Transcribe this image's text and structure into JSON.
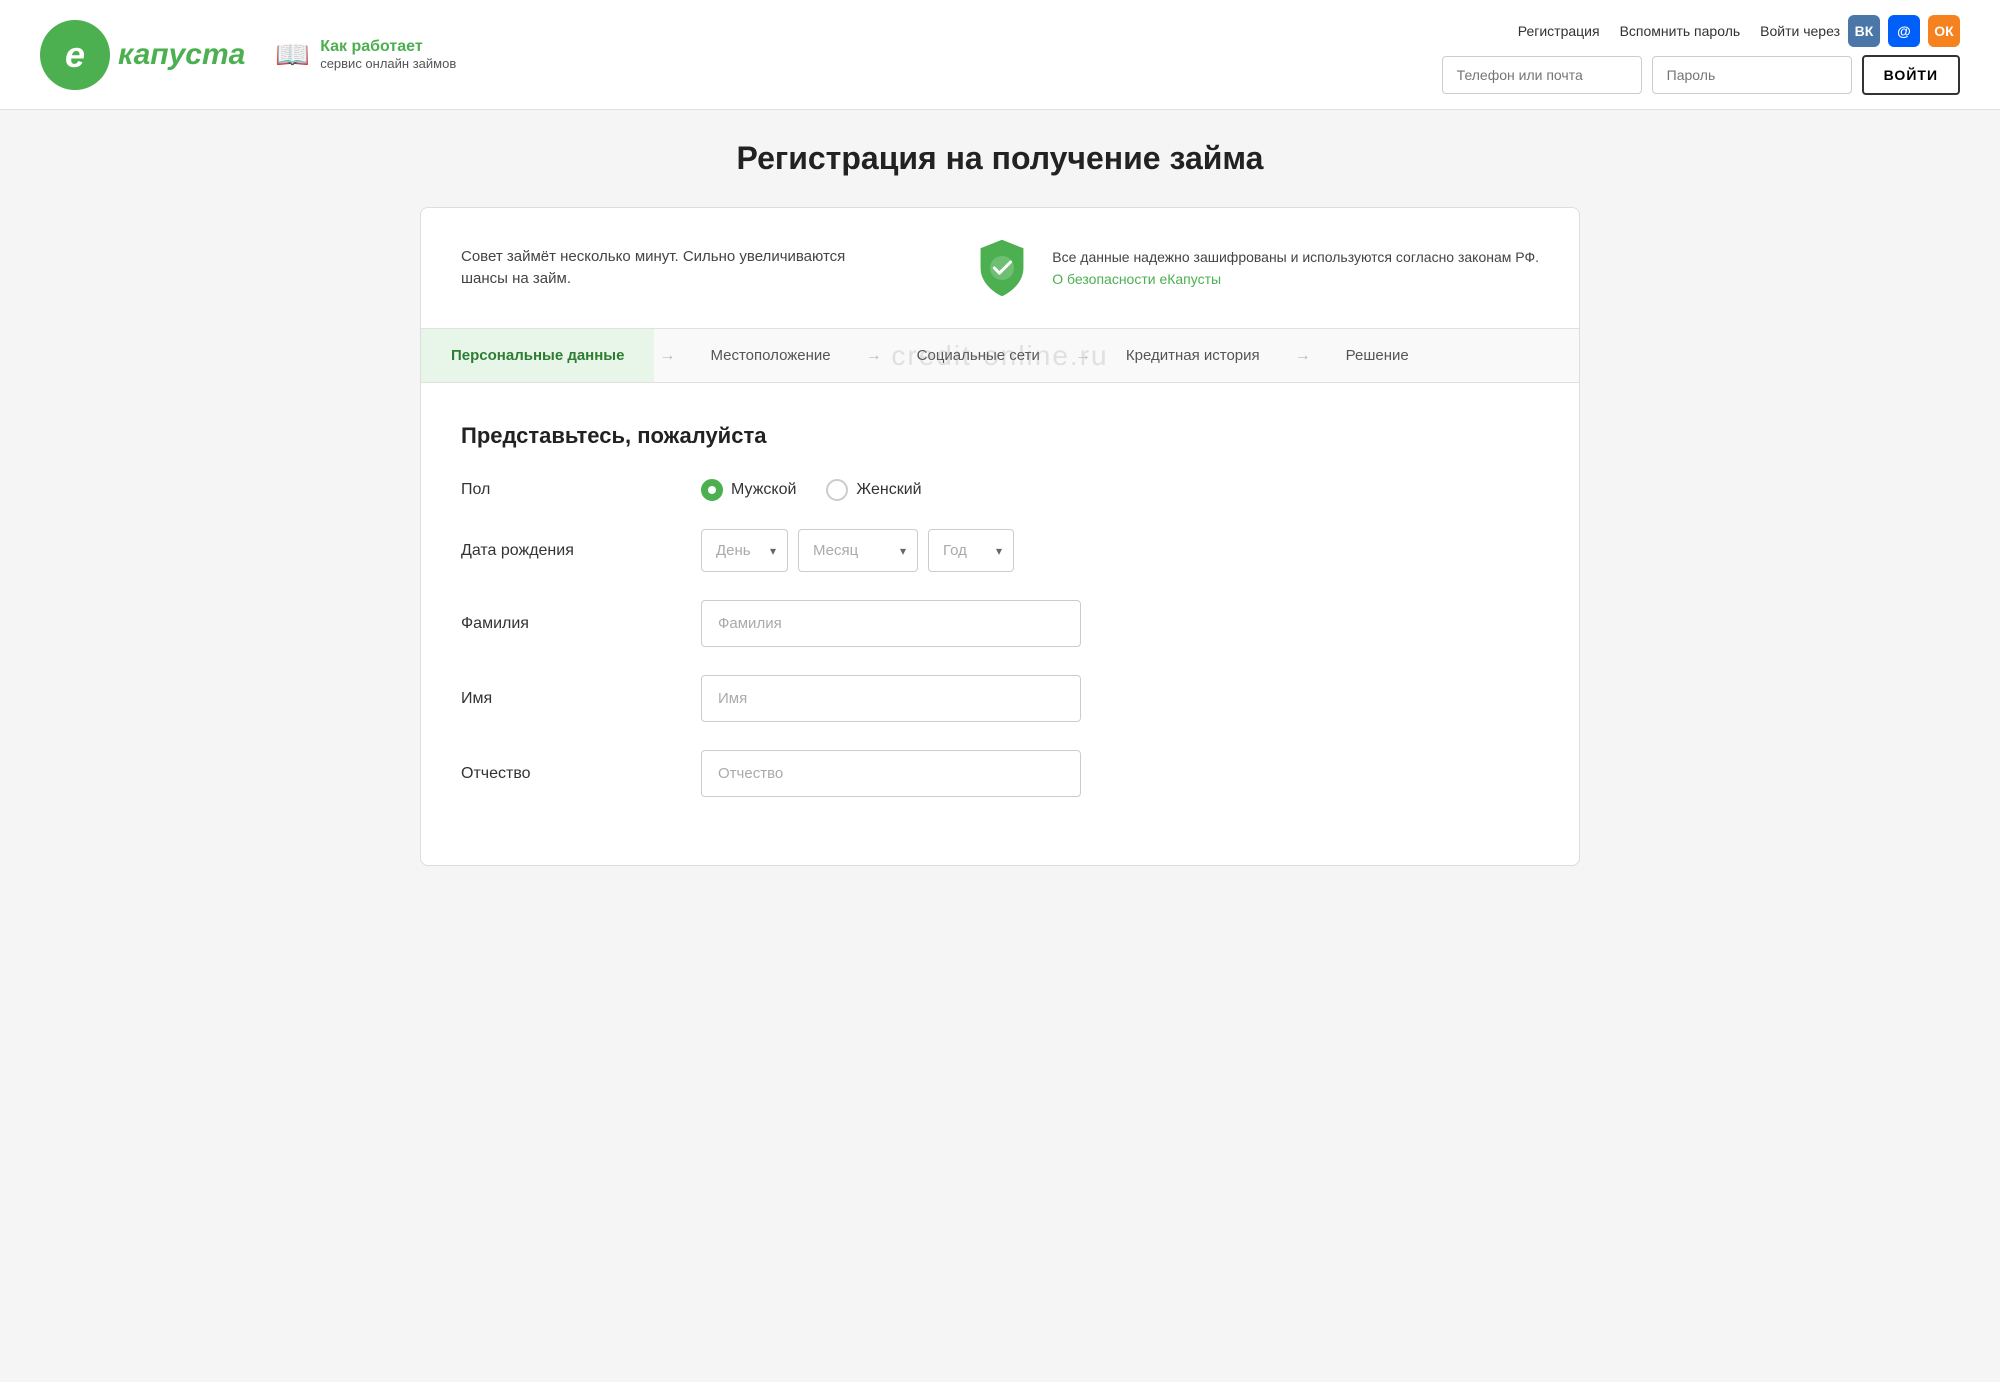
{
  "header": {
    "logo_letter": "e",
    "logo_name": "капуста",
    "how_line1": "Как работает",
    "how_line2": "сервис онлайн займов",
    "links": {
      "registration": "Регистрация",
      "remind_password": "Вспомнить пароль"
    },
    "social_label": "Войти через",
    "phone_placeholder": "Телефон или почта",
    "password_placeholder": "Пароль",
    "login_button": "ВОЙТИ"
  },
  "page": {
    "title": "Регистрация на получение займа"
  },
  "info_banner": {
    "left_text": "Совет займёт несколько минут. Сильно увеличиваются шансы на займ.",
    "right_text": "Все данные надежно зашифрованы и используются согласно законам РФ.",
    "security_link": "О безопасности еКапусты"
  },
  "steps": [
    {
      "label": "Персональные данные",
      "active": true
    },
    {
      "label": "Местоположение",
      "active": false
    },
    {
      "label": "Социальные сети",
      "active": false
    },
    {
      "label": "Кредитная история",
      "active": false
    },
    {
      "label": "Решение",
      "active": false
    }
  ],
  "form": {
    "section_title": "Представьтесь, пожалуйста",
    "gender_label": "Пол",
    "gender_male": "Мужской",
    "gender_female": "Женский",
    "dob_label": "Дата рождения",
    "dob_day_placeholder": "День",
    "dob_month_placeholder": "Месяц",
    "dob_year_placeholder": "Год",
    "lastname_label": "Фамилия",
    "lastname_placeholder": "Фамилия",
    "firstname_label": "Имя",
    "firstname_placeholder": "Имя",
    "patronymic_label": "Отчество",
    "patronymic_placeholder": "Отчество"
  },
  "watermark": "credit-online.ru"
}
